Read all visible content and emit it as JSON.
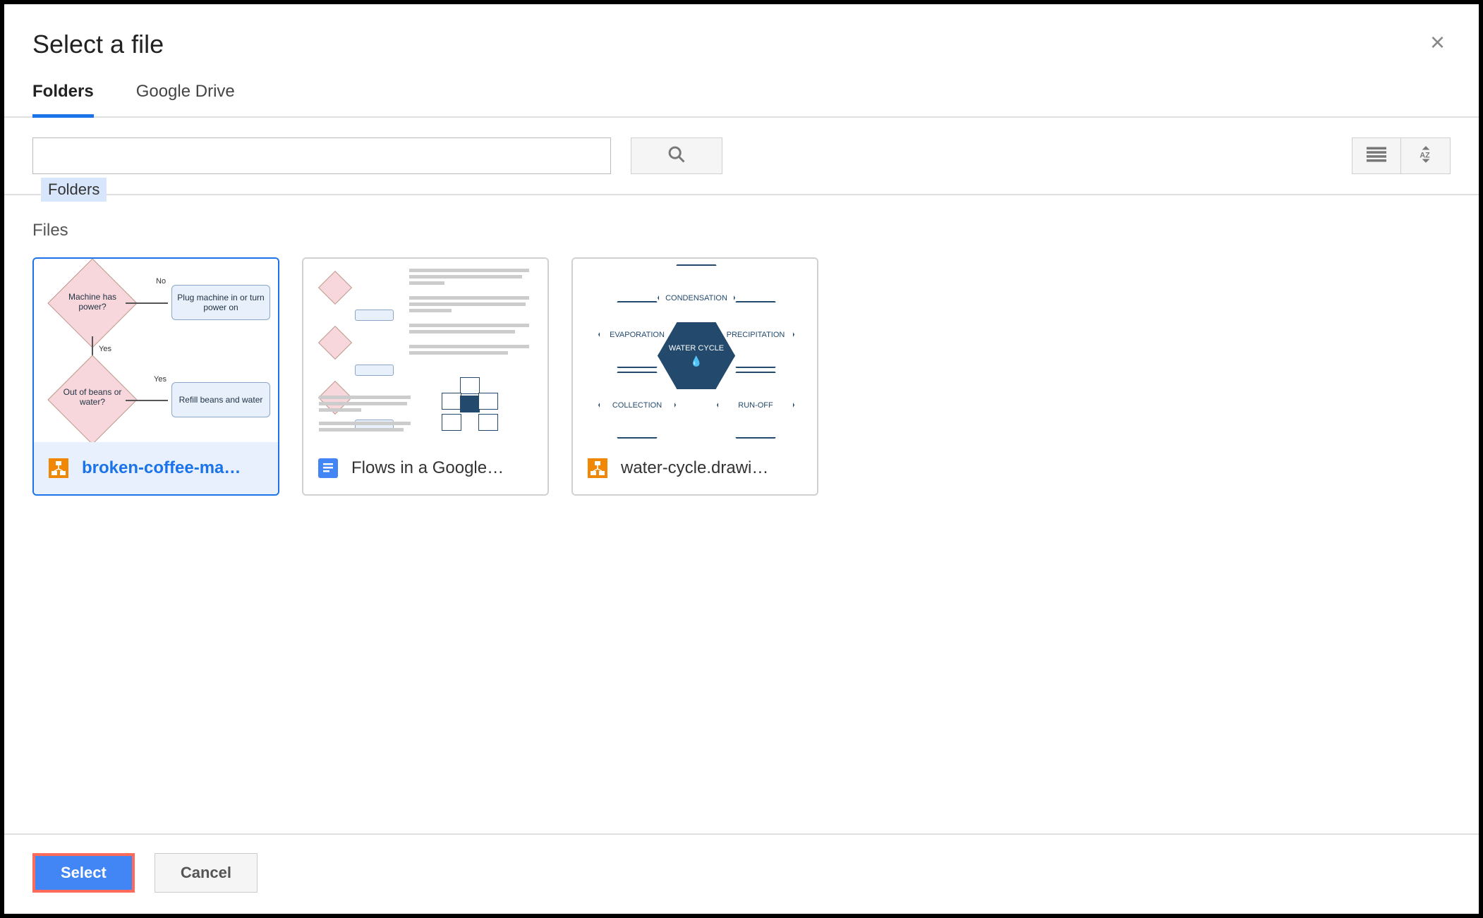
{
  "dialog": {
    "title": "Select a file",
    "tabs": [
      {
        "label": "Folders",
        "active": true
      },
      {
        "label": "Google Drive",
        "active": false
      }
    ],
    "search": {
      "chip": "Folders"
    },
    "section_label": "Files",
    "files": [
      {
        "name": "broken-coffee-ma…",
        "type": "drawio",
        "selected": true,
        "thumb_texts": {
          "q1": "Machine has power?",
          "a1": "Plug machine in or turn power on",
          "no": "No",
          "yes": "Yes",
          "q2": "Out of beans or water?",
          "a2": "Refill beans and water",
          "yes2": "Yes"
        }
      },
      {
        "name": "Flows in a Google…",
        "type": "gdoc",
        "selected": false
      },
      {
        "name": "water-cycle.drawi…",
        "type": "drawio",
        "selected": false,
        "hex_labels": {
          "center": "WATER CYCLE",
          "top": "CONDENSATION",
          "tl": "EVAPORATION",
          "tr": "PRECIPITATION",
          "bl": "COLLECTION",
          "br": "RUN-OFF"
        }
      }
    ],
    "buttons": {
      "select": "Select",
      "cancel": "Cancel"
    }
  }
}
